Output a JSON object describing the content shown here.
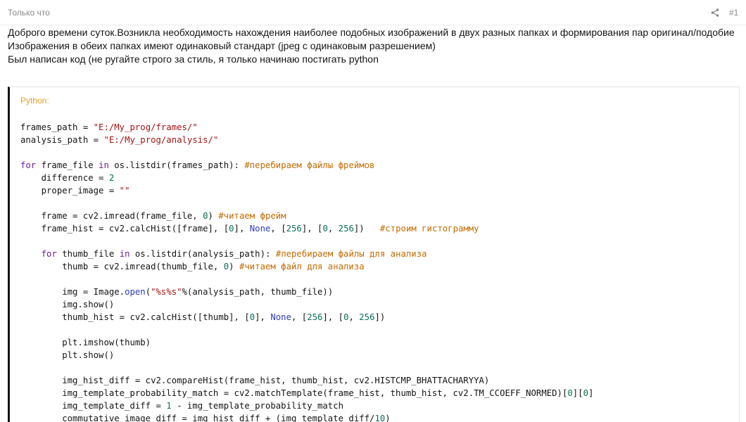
{
  "header": {
    "time": "Только что",
    "post_number": "#1",
    "share_icon": "share-icon"
  },
  "message": {
    "paragraphs": [
      "Доброго времени суток.Возникла необходимость нахождения наиболее подобных изображений в двух разных папках и формирования пар оригинал/подобие",
      "Изображения в обеих папках имеют одинаковый стандарт (jpeg с одинаковым разрешением)",
      "Был написан код (не ругайте строго за стиль, я только начинаю постигать python"
    ]
  },
  "code_block": {
    "language_label": "Python:",
    "lines": [
      [
        {
          "t": "frames_path = "
        },
        {
          "t": "\"E:/My_prog/frames/\"",
          "c": "str"
        }
      ],
      [
        {
          "t": "analysis_path = "
        },
        {
          "t": "\"E:/My_prog/analysis/\"",
          "c": "str"
        }
      ],
      [],
      [
        {
          "t": "for",
          "c": "kw"
        },
        {
          "t": " frame_file "
        },
        {
          "t": "in",
          "c": "kw"
        },
        {
          "t": " os.listdir(frames_path): "
        },
        {
          "t": "#перебираем файлы фреймов",
          "c": "cmt"
        }
      ],
      [
        {
          "t": "    difference = "
        },
        {
          "t": "2",
          "c": "num"
        }
      ],
      [
        {
          "t": "    proper_image = "
        },
        {
          "t": "\"\"",
          "c": "str"
        }
      ],
      [],
      [
        {
          "t": "    frame = cv2.imread(frame_file, "
        },
        {
          "t": "0",
          "c": "num"
        },
        {
          "t": ") "
        },
        {
          "t": "#читаем фрейм",
          "c": "cmt"
        }
      ],
      [
        {
          "t": "    frame_hist = cv2.calcHist([frame], ["
        },
        {
          "t": "0",
          "c": "num"
        },
        {
          "t": "], "
        },
        {
          "t": "None",
          "c": "builtin"
        },
        {
          "t": ", ["
        },
        {
          "t": "256",
          "c": "num"
        },
        {
          "t": "], ["
        },
        {
          "t": "0",
          "c": "num"
        },
        {
          "t": ", "
        },
        {
          "t": "256",
          "c": "num"
        },
        {
          "t": "])   "
        },
        {
          "t": "#строим гистограмму",
          "c": "cmt"
        }
      ],
      [],
      [
        {
          "t": "    "
        },
        {
          "t": "for",
          "c": "kw"
        },
        {
          "t": " thumb_file "
        },
        {
          "t": "in",
          "c": "kw"
        },
        {
          "t": " os.listdir(analysis_path): "
        },
        {
          "t": "#перебираем файлы для анализа",
          "c": "cmt"
        }
      ],
      [
        {
          "t": "        thumb = cv2.imread(thumb_file, "
        },
        {
          "t": "0",
          "c": "num"
        },
        {
          "t": ") "
        },
        {
          "t": "#читаем файл для анализа",
          "c": "cmt"
        }
      ],
      [],
      [
        {
          "t": "        img = Image."
        },
        {
          "t": "open",
          "c": "builtin"
        },
        {
          "t": "("
        },
        {
          "t": "\"%s%s\"",
          "c": "str"
        },
        {
          "t": "%(analysis_path, thumb_file))"
        }
      ],
      [
        {
          "t": "        img.show()"
        }
      ],
      [
        {
          "t": "        thumb_hist = cv2.calcHist([thumb], ["
        },
        {
          "t": "0",
          "c": "num"
        },
        {
          "t": "], "
        },
        {
          "t": "None",
          "c": "builtin"
        },
        {
          "t": ", ["
        },
        {
          "t": "256",
          "c": "num"
        },
        {
          "t": "], ["
        },
        {
          "t": "0",
          "c": "num"
        },
        {
          "t": ", "
        },
        {
          "t": "256",
          "c": "num"
        },
        {
          "t": "])"
        }
      ],
      [],
      [
        {
          "t": "        plt.imshow(thumb)"
        }
      ],
      [
        {
          "t": "        plt.show()"
        }
      ],
      [],
      [
        {
          "t": "        img_hist_diff = cv2.compareHist(frame_hist, thumb_hist, cv2.HISTCMP_BHATTACHARYYA)"
        }
      ],
      [
        {
          "t": "        img_template_probability_match = cv2.matchTemplate(frame_hist, thumb_hist, cv2.TM_CCOEFF_NORMED)["
        },
        {
          "t": "0",
          "c": "num"
        },
        {
          "t": "]["
        },
        {
          "t": "0",
          "c": "num"
        },
        {
          "t": "]"
        }
      ],
      [
        {
          "t": "        img_template_diff = "
        },
        {
          "t": "1",
          "c": "num"
        },
        {
          "t": " - img_template_probability_match"
        }
      ],
      [
        {
          "t": "        commutative_image_diff = img_hist_diff + (img_template_diff/"
        },
        {
          "t": "10",
          "c": "num"
        },
        {
          "t": ")"
        }
      ]
    ]
  }
}
